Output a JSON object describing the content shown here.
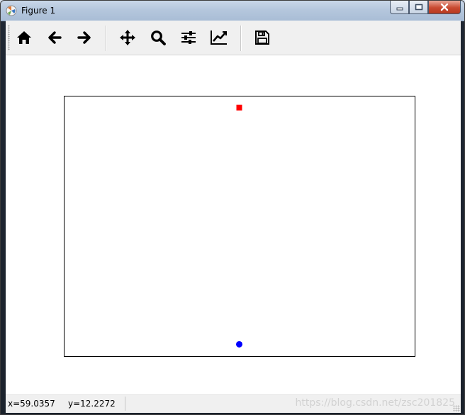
{
  "window": {
    "title": "Figure 1",
    "controls": {
      "minimize": "minimize-icon",
      "maximize": "maximize-icon",
      "close": "close-icon"
    }
  },
  "toolbar": {
    "buttons": [
      {
        "name": "home",
        "icon": "home-icon"
      },
      {
        "name": "back",
        "icon": "arrow-left-icon"
      },
      {
        "name": "forward",
        "icon": "arrow-right-icon"
      },
      {
        "name": "pan",
        "icon": "move-icon"
      },
      {
        "name": "zoom",
        "icon": "magnifier-icon"
      },
      {
        "name": "configure-subplots",
        "icon": "sliders-icon"
      },
      {
        "name": "edit-axes",
        "icon": "line-chart-icon"
      },
      {
        "name": "save",
        "icon": "floppy-disk-icon"
      }
    ]
  },
  "status": {
    "x_readout": "x=59.0357",
    "y_readout": "y=12.2272",
    "watermark": "https://blog.csdn.net/zsc201825"
  },
  "chart_data": {
    "type": "scatter",
    "title": "",
    "xlabel": "",
    "ylabel": "",
    "axes_visible": false,
    "grid": false,
    "series": [
      {
        "marker": "square",
        "color": "#ff0000",
        "points": [
          {
            "x": 0,
            "y": 1
          }
        ]
      },
      {
        "marker": "circle",
        "color": "#0000ff",
        "points": [
          {
            "x": 0,
            "y": 0
          }
        ]
      }
    ],
    "xlim": [
      -1,
      1
    ],
    "ylim": [
      -0.05,
      1.05
    ]
  },
  "colors": {
    "toolbar_bg": "#f0f0f0",
    "axes_edge": "#000000",
    "titlebar": "#b5c7dd",
    "close_button": "#c84a31"
  }
}
